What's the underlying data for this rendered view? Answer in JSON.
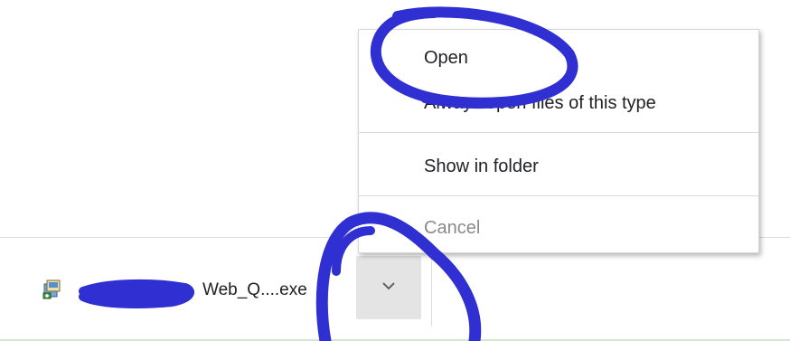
{
  "download_shelf": {
    "item": {
      "file_name_visible": "Web_Q....exe",
      "icon": "installer-icon"
    },
    "expand_button_icon": "chevron-down-icon"
  },
  "context_menu": {
    "items": [
      {
        "label": "Open",
        "enabled": true
      },
      {
        "label": "Always open files of this type",
        "enabled": true
      },
      {
        "label": "Show in folder",
        "enabled": true
      },
      {
        "label": "Cancel",
        "enabled": false
      }
    ]
  },
  "colors": {
    "annotation_ink": "#2f2fd2",
    "shelf_button_bg": "#e4e4e4",
    "disabled_text": "#8a8a8a"
  }
}
